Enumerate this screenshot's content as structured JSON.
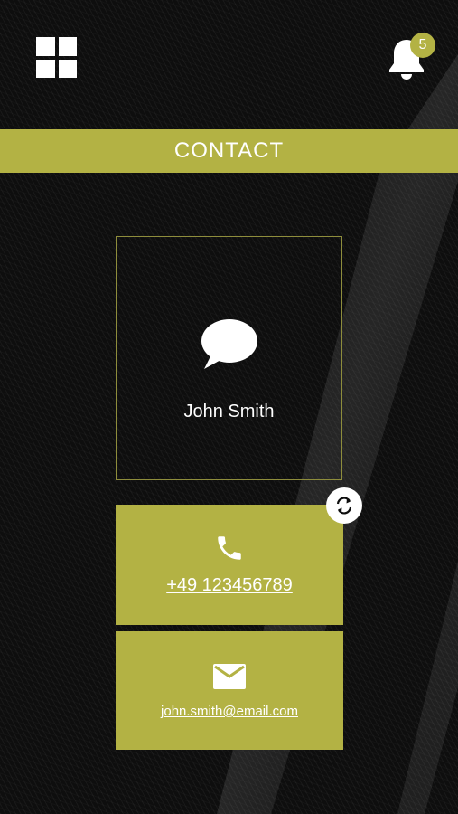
{
  "header": {
    "menu_icon": "grid-icon",
    "bell_icon": "bell-icon",
    "notification_count": "5"
  },
  "page": {
    "title": "CONTACT"
  },
  "contact": {
    "icon": "chat-bubble-icon",
    "name": "John Smith",
    "phone": "+49 123456789",
    "phone_icon": "phone-icon",
    "email": "john.smith@email.com",
    "email_icon": "mail-icon",
    "swap_icon": "swap-icon"
  },
  "colors": {
    "accent": "#b3b244",
    "background": "#0e0e0e",
    "text": "#ffffff"
  }
}
